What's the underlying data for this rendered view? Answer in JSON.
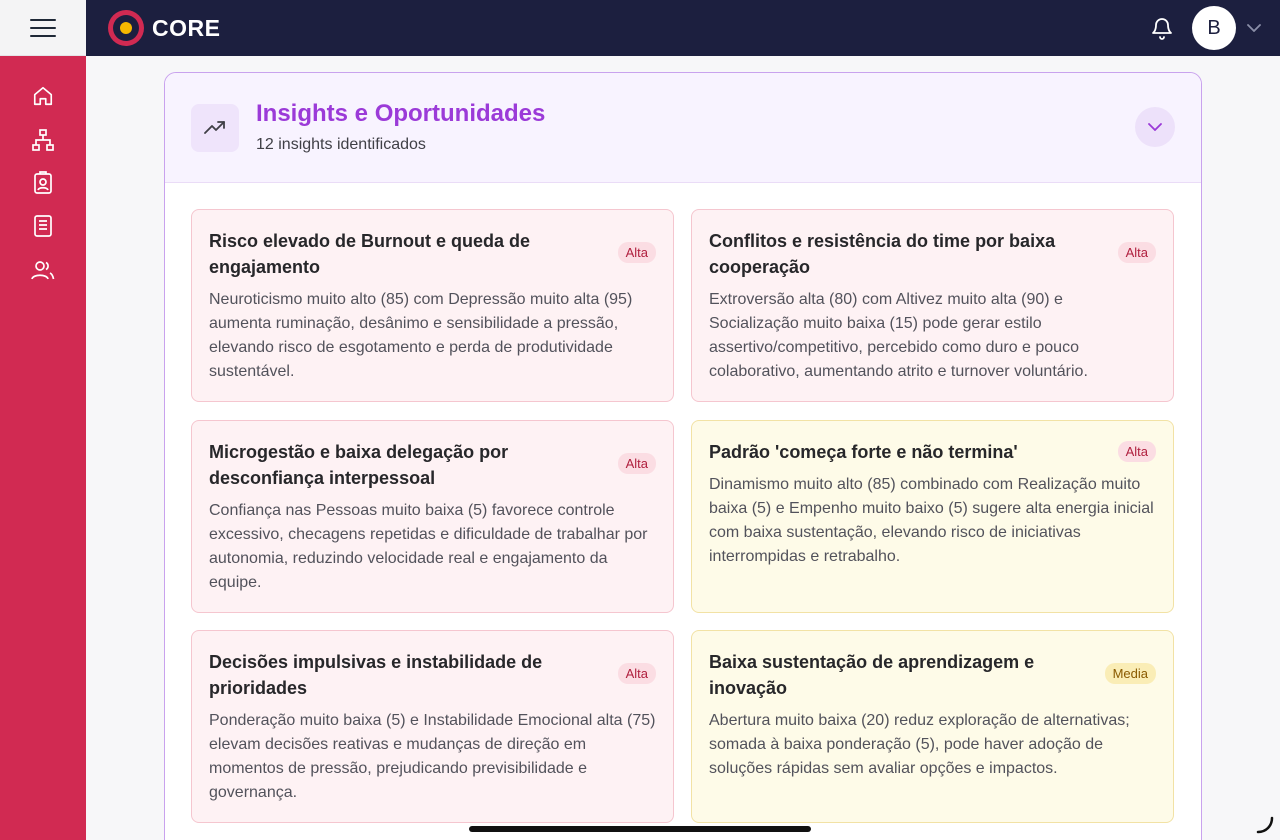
{
  "app": {
    "brand": "CORE"
  },
  "header": {
    "avatar_initial": "B"
  },
  "sidebar": {
    "items": [
      {
        "name": "home-icon"
      },
      {
        "name": "org-chart-icon"
      },
      {
        "name": "badge-icon"
      },
      {
        "name": "document-icon"
      },
      {
        "name": "users-icon"
      }
    ]
  },
  "insights": {
    "title": "Insights e Oportunidades",
    "subtitle": "12 insights identificados",
    "cards": [
      {
        "title": "Risco elevado de Burnout e queda de engajamento",
        "priority": "Alta",
        "description": "Neuroticismo muito alto (85) com Depressão muito alta (95) aumenta ruminação, desânimo e sensibilidade a pressão, elevando risco de esgotamento e perda de produtividade sustentável."
      },
      {
        "title": "Conflitos e resistência do time por baixa cooperação",
        "priority": "Alta",
        "description": "Extroversão alta (80) com Altivez muito alta (90) e Socialização muito baixa (15) pode gerar estilo assertivo/competitivo, percebido como duro e pouco colaborativo, aumentando atrito e turnover voluntário."
      },
      {
        "title": "Microgestão e baixa delegação por desconfiança interpessoal",
        "priority": "Alta",
        "description": "Confiança nas Pessoas muito baixa (5) favorece controle excessivo, checagens repetidas e dificuldade de trabalhar por autonomia, reduzindo velocidade real e engajamento da equipe."
      },
      {
        "title": "Padrão 'começa forte e não termina'",
        "priority": "Alta",
        "description": "Dinamismo muito alto (85) combinado com Realização muito baixa (5) e Empenho muito baixo (5) sugere alta energia inicial com baixa sustentação, elevando risco de iniciativas interrompidas e retrabalho."
      },
      {
        "title": "Decisões impulsivas e instabilidade de prioridades",
        "priority": "Alta",
        "description": "Ponderação muito baixa (5) e Instabilidade Emocional alta (75) elevam decisões reativas e mudanças de direção em momentos de pressão, prejudicando previsibilidade e governança."
      },
      {
        "title": "Baixa sustentação de aprendizagem e inovação",
        "priority": "Media",
        "description": "Abertura muito baixa (20) reduz exploração de alternativas; somada à baixa ponderação (5), pode haver adoção de soluções rápidas sem avaliar opções e impactos."
      }
    ]
  },
  "colors": {
    "topbar": "#1c1f3f",
    "sidebar": "#d12a52",
    "accent_purple": "#9b3ad8",
    "high_card_bg": "#fef2f4",
    "medium_card_bg": "#fefbe8"
  }
}
